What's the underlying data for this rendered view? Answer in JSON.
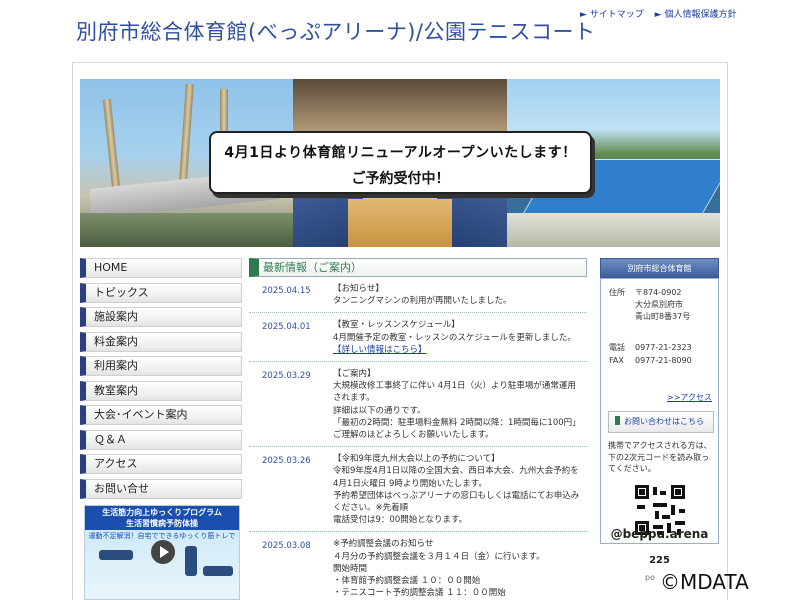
{
  "site_title": "別府市総合体育館(べっぷアリーナ)/公園テニスコート",
  "top_links": [
    "► サイトマップ",
    "► 個人情報保護方針"
  ],
  "banner": {
    "notice_line1": "4月1日より体育館リニューアルオープンいたします！",
    "notice_line2": "ご予約受付中！"
  },
  "nav": [
    "HOME",
    "トピックス",
    "施設案内",
    "料金案内",
    "利用案内",
    "教室案内",
    "大会･イベント案内",
    "Ｑ＆Ａ",
    "アクセス",
    "お問い合せ"
  ],
  "promo": {
    "title": "生活筋力向上ゆっくりプログラム",
    "title2": "生活習慣病予防体操",
    "subtitle": "運動不足解消！自宅でできるゆっくり筋トレです。"
  },
  "news": {
    "heading": "最新情報（ご案内）",
    "items": [
      {
        "date": "2025.04.15",
        "lines": [
          "【お知らせ】",
          "タンニングマシンの利用が再開いたしました。"
        ]
      },
      {
        "date": "2025.04.01",
        "lines": [
          "【教室・レッスンスケジュール】",
          "4月開催予定の教室・レッスンのスケジュールを更新しました。"
        ],
        "link": "【詳しい情報はこちら】"
      },
      {
        "date": "2025.03.29",
        "lines": [
          "【ご案内】",
          "大規模改修工事終了に伴い 4月1日（火）より駐車場が通常運用",
          "されます。",
          "詳細は以下の通りです。",
          "「最初の2時間：駐車場料金無料 2時間以降：1時間毎に100円」",
          "ご理解のほどよろしくお願いいたします。"
        ]
      },
      {
        "date": "2025.03.26",
        "lines": [
          "【令和9年度九州大会以上の予約について】",
          "令和9年度4月1日以降の全国大会、西日本大会、九州大会予約を",
          "4月1日火曜日 9時より開始いたします。",
          "予約希望団体はべっぷアリーナの窓口もしくは電話にてお申込み",
          "ください。※先着順",
          "電話受付は9：00開始となります。"
        ]
      },
      {
        "date": "2025.03.08",
        "lines": [
          "※予約調整会議のお知らせ",
          "４月分の予約調整会議を３月１４日（金）に行います。",
          "開始時間",
          "・体育館予約調整会議 １０：００開始",
          "・テニスコート予約調整会議 １１：００開始"
        ]
      }
    ]
  },
  "sidebar": {
    "heading": "別府市総合体育館",
    "address_label": "住所",
    "address": [
      "〒874-0902",
      "大分県別府市",
      "青山町8番37号"
    ],
    "tel_label": "電話",
    "tel": "0977-21-2323",
    "fax_label": "FAX",
    "fax": "0977-21-8090",
    "access_link": ">>アクセス",
    "contact_button": "お問い合わせはこちら",
    "qr_text": "携帯でアクセスされる方は、下の2次元コードを読み取ってください。"
  },
  "instagram": {
    "handle": "@beppu.arena",
    "count": "225",
    "posts_label": "po"
  },
  "watermark": "©MDATA"
}
